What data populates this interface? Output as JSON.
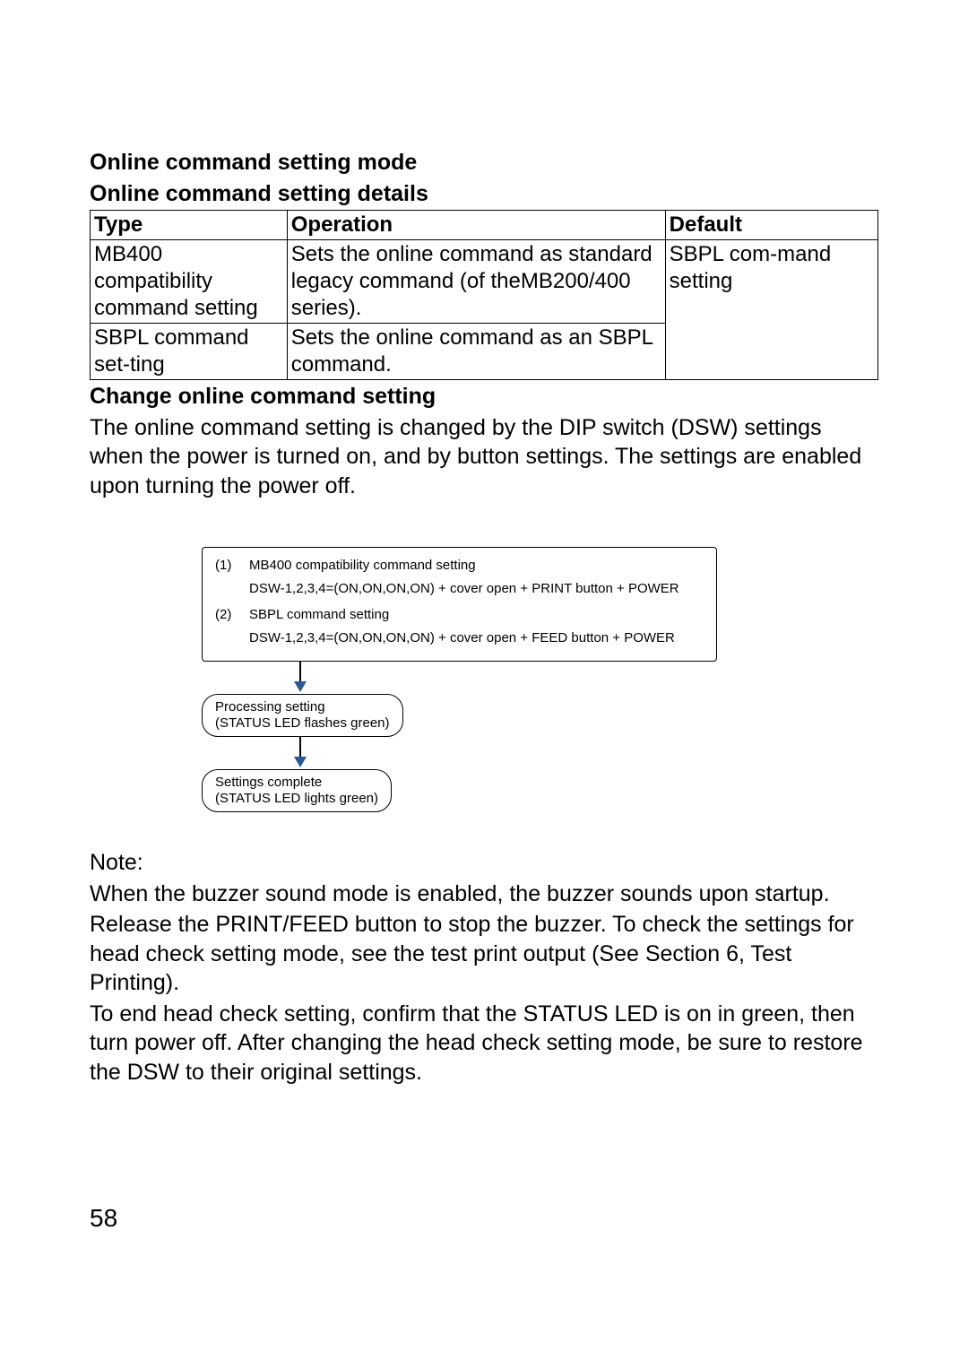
{
  "headings": {
    "h1": "Online command setting mode",
    "h2": "Online command setting details",
    "hChange": "Change online command setting"
  },
  "table": {
    "headers": {
      "c1": "Type",
      "c2": "Operation",
      "c3": "Default"
    },
    "rows": [
      {
        "type": "MB400 compatibility command setting",
        "op": "Sets the online command as standard legacy command (of theMB200/400 series).",
        "def": "SBPL com-mand setting"
      },
      {
        "type": "SBPL command set-ting",
        "op": "Sets the online command as an SBPL command.",
        "def": ""
      }
    ]
  },
  "paragraphs": {
    "p1": "The online command setting is changed by the DIP switch (DSW) settings when the power is turned on, and by button settings. The settings are enabled upon turning the power off.",
    "noteLabel": "Note:",
    "note1": "When the buzzer sound mode is enabled, the buzzer sounds upon startup.",
    "note2": "Release the PRINT/FEED button to stop the buzzer. To check the settings for head check setting mode, see the test print output (See Section 6, Test Printing).",
    "note3": "To end head check setting, confirm that the STATUS LED is on in green, then turn power off. After changing the head check setting mode, be sure to restore the DSW to their original settings."
  },
  "flow": {
    "item1_num": "(1)",
    "item1_title": "MB400 compatibility command setting",
    "item1_detail": "DSW-1,2,3,4=(ON,ON,ON,ON) + cover open + PRINT button + POWER",
    "item2_num": "(2)",
    "item2_title": "SBPL command setting",
    "item2_detail": "DSW-1,2,3,4=(ON,ON,ON,ON) + cover open + FEED button + POWER",
    "proc1": "Processing setting",
    "proc2": "(STATUS LED flashes green)",
    "done1": "Settings complete",
    "done2": "(STATUS LED lights green)"
  },
  "pageNumber": "58"
}
